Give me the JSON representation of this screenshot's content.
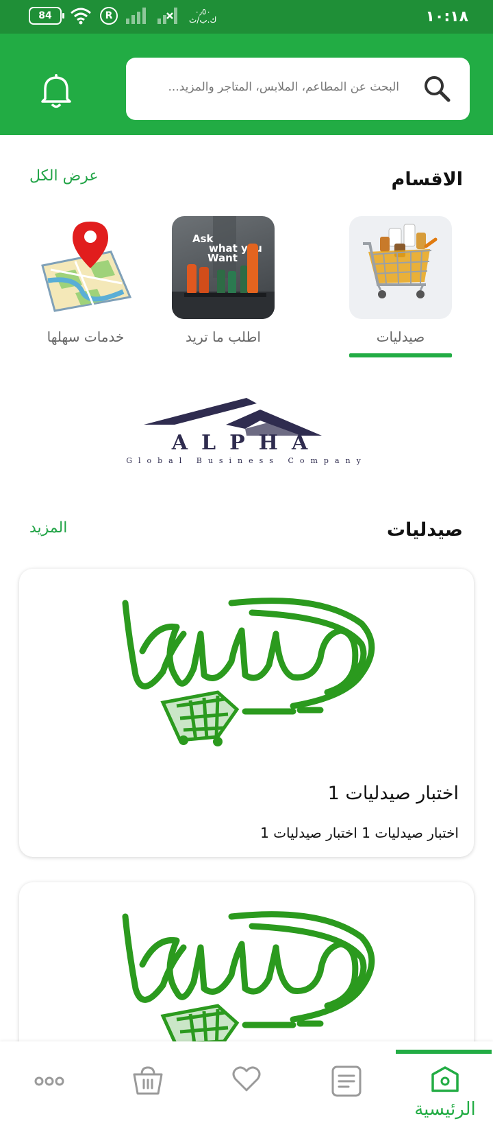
{
  "status_bar": {
    "time": "١٠:١٨",
    "battery": "84",
    "net_speed_value": "٠٫٥٠",
    "net_speed_unit": "ك.ب/ث",
    "reg_mark": "R"
  },
  "header": {
    "search_placeholder": "البحث عن المطاعم، الملابس، المتاجر والمزيد...",
    "icons": {
      "search": "search-icon",
      "notifications": "bell-icon"
    }
  },
  "categories_section": {
    "title": "الاقسام",
    "view_all": "عرض الكل",
    "items": [
      {
        "label": "صيدليات",
        "icon": "pharmacy-cart-image",
        "selected": true
      },
      {
        "label": "اطلب ما تريد",
        "icon": "ask-what-you-want-image",
        "image_text": "Ask what you Want",
        "selected": false
      },
      {
        "label": "خدمات سهلها",
        "icon": "map-pin-image",
        "selected": false
      }
    ]
  },
  "banner": {
    "brand": "ALPHA",
    "tagline": "Global Business Company"
  },
  "pharmacies_section": {
    "title": "صيدليات",
    "more": "المزيد",
    "cards": [
      {
        "logo": "sahlha-logo",
        "title": "اختبار صيدليات 1",
        "desc": "اختبار صيدليات 1 اختبار صيدليات 1"
      },
      {
        "logo": "sahlha-logo"
      }
    ]
  },
  "bottom_nav": {
    "items": [
      {
        "icon": "home-icon",
        "label": "الرئيسية",
        "active": true
      },
      {
        "icon": "orders-icon",
        "label": "",
        "active": false
      },
      {
        "icon": "favorites-icon",
        "label": "",
        "active": false
      },
      {
        "icon": "basket-icon",
        "label": "",
        "active": false
      },
      {
        "icon": "more-icon",
        "label": "",
        "active": false
      }
    ]
  },
  "colors": {
    "brand_green": "#22ac44",
    "status_green": "#1f8f37",
    "link_green": "#22a447",
    "logo_green": "#2b9a1e",
    "alpha_navy": "#2f2c4f"
  }
}
